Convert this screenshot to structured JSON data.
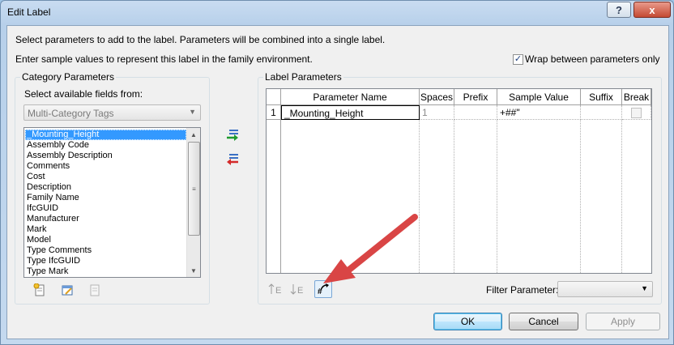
{
  "window": {
    "title": "Edit Label",
    "help_label": "?",
    "close_label": "x"
  },
  "instructions": {
    "line1": "Select parameters to add to the label.  Parameters will be combined into a single label.",
    "line2": "Enter sample values to represent this label in the family environment."
  },
  "wrap": {
    "label": "Wrap between parameters only",
    "checked": true,
    "check_glyph": "✓"
  },
  "category": {
    "title": "Category Parameters",
    "fields_label": "Select available fields from:",
    "combo_value": "Multi-Category Tags",
    "items": [
      "_Mounting_Height",
      "Assembly Code",
      "Assembly Description",
      "Comments",
      "Cost",
      "Description",
      "Family Name",
      "IfcGUID",
      "Manufacturer",
      "Mark",
      "Model",
      "Type Comments",
      "Type IfcGUID",
      "Type Mark"
    ],
    "selected_index": 0,
    "icons": [
      "new-parameter-icon",
      "edit-parameter-icon",
      "add-to-label-icon"
    ]
  },
  "transfer": {
    "icons": [
      "add-parameter-icon",
      "remove-parameter-icon"
    ]
  },
  "label": {
    "title": "Label Parameters",
    "columns": [
      "Parameter Name",
      "Spaces",
      "Prefix",
      "Sample Value",
      "Suffix",
      "Break"
    ],
    "rows": [
      {
        "num": "1",
        "name": "_Mounting_Height",
        "spaces": "1",
        "prefix": "",
        "sample": "+##\"",
        "suffix": "",
        "break": false
      }
    ],
    "filter_label": "Filter Parameter:",
    "filter_value": "",
    "icons": [
      "move-up-icon",
      "move-down-icon",
      "edit-units-format-icon"
    ]
  },
  "annotation": {
    "color": "#d94545"
  },
  "buttons": {
    "ok": "OK",
    "cancel": "Cancel",
    "apply": "Apply"
  }
}
